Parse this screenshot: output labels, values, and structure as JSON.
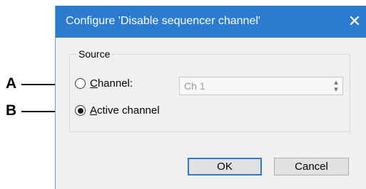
{
  "dialog": {
    "title": "Configure 'Disable sequencer channel'",
    "close_glyph": "✕"
  },
  "source": {
    "legend": "Source",
    "channel_radio": {
      "accel": "C",
      "rest": "hannel:",
      "selected": false
    },
    "active_radio": {
      "accel": "A",
      "rest": "ctive channel",
      "selected": true
    },
    "channel_spin": {
      "value": "Ch 1",
      "enabled": false
    }
  },
  "buttons": {
    "ok": "OK",
    "cancel": "Cancel"
  },
  "callouts": {
    "a": "A",
    "b": "B"
  },
  "colors": {
    "titlebar": "#2b7bd0",
    "body": "#f0f0f0",
    "default_button_border": "#2d7ad0"
  }
}
